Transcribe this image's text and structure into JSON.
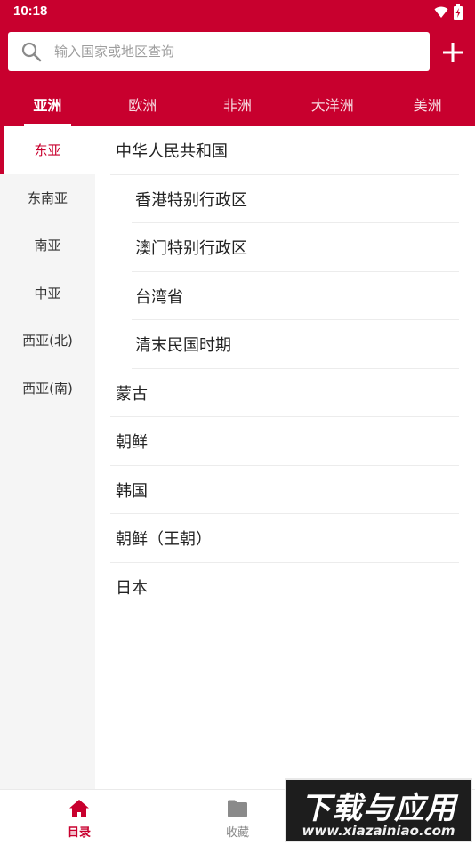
{
  "status_bar": {
    "time": "10:18"
  },
  "search": {
    "placeholder": "输入国家或地区查询"
  },
  "tabs": [
    {
      "label": "亚洲",
      "active": true
    },
    {
      "label": "欧洲",
      "active": false
    },
    {
      "label": "非洲",
      "active": false
    },
    {
      "label": "大洋洲",
      "active": false
    },
    {
      "label": "美洲",
      "active": false
    }
  ],
  "sidebar": {
    "items": [
      {
        "label": "东亚",
        "active": true
      },
      {
        "label": "东南亚",
        "active": false
      },
      {
        "label": "南亚",
        "active": false
      },
      {
        "label": "中亚",
        "active": false
      },
      {
        "label": "西亚(北)",
        "active": false
      },
      {
        "label": "西亚(南)",
        "active": false
      }
    ]
  },
  "list": {
    "items": [
      {
        "label": "中华人民共和国",
        "level": 0
      },
      {
        "label": "香港特别行政区",
        "level": 1
      },
      {
        "label": "澳门特别行政区",
        "level": 1
      },
      {
        "label": "台湾省",
        "level": 1
      },
      {
        "label": "清末民国时期",
        "level": 1
      },
      {
        "label": "蒙古",
        "level": 0
      },
      {
        "label": "朝鲜",
        "level": 0
      },
      {
        "label": "韩国",
        "level": 0
      },
      {
        "label": "朝鲜（王朝）",
        "level": 0
      },
      {
        "label": "日本",
        "level": 0
      }
    ]
  },
  "bottom_nav": {
    "home_label": "目录",
    "favorites_label": "收藏"
  },
  "watermark": {
    "title": "下载与应用",
    "url": "www.xiazainiao.com"
  },
  "colors": {
    "brand": "#C8002E",
    "sidebar_bg": "#f5f5f5",
    "inactive_icon": "#888888"
  },
  "icons": {
    "wifi": "wifi-icon",
    "battery": "battery-charging-icon",
    "search": "search-icon",
    "add": "plus-icon",
    "home": "home-icon",
    "favorites": "folder-icon"
  }
}
